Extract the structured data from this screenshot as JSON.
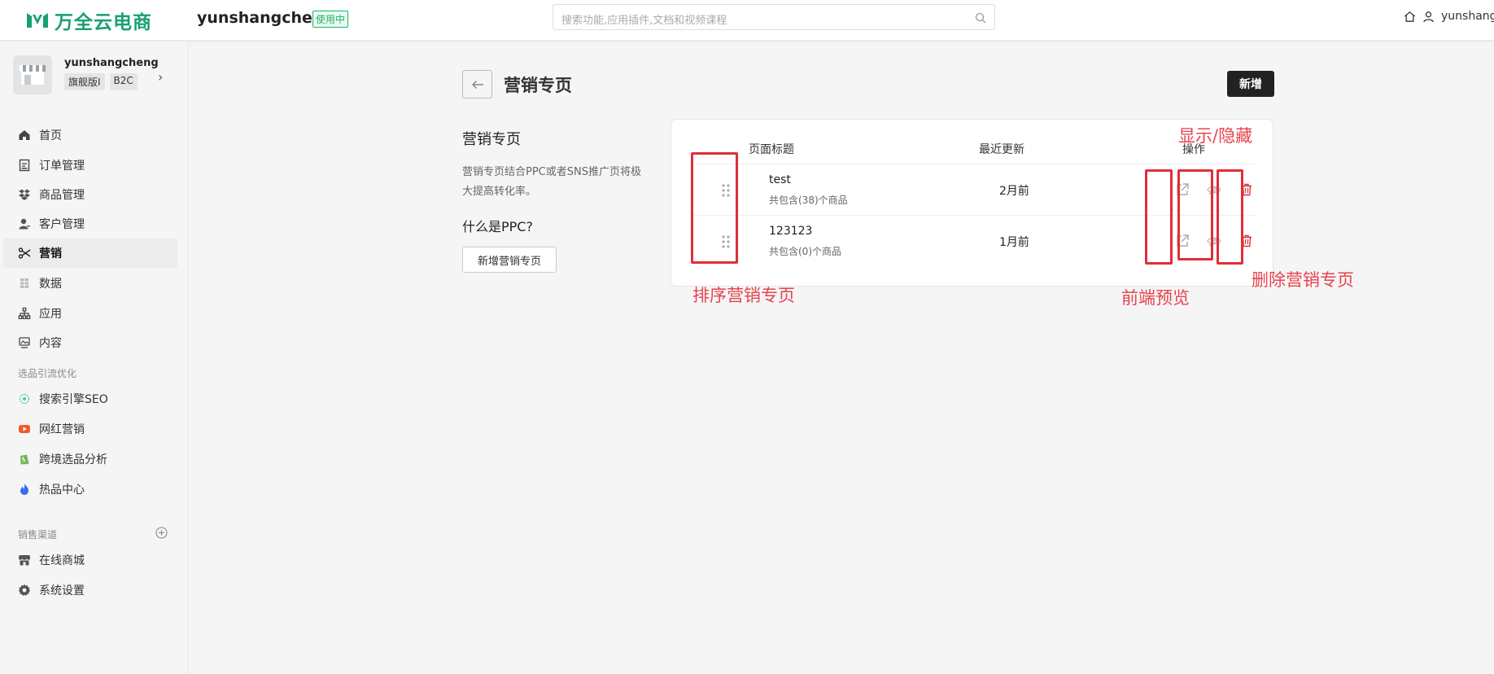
{
  "topbar": {
    "logo_text": "万全云电商",
    "store_name": "yunshangcheng",
    "store_status": "使用中",
    "search_placeholder": "搜索功能,应用插件,文档和视频课程",
    "user_name": "yunshangcheng"
  },
  "shop": {
    "name": "yunshangcheng",
    "tags": [
      "旗舰版I",
      "B2C"
    ]
  },
  "nav": {
    "main_items": [
      {
        "label": "首页",
        "icon": "home-icon"
      },
      {
        "label": "订单管理",
        "icon": "order-icon"
      },
      {
        "label": "商品管理",
        "icon": "product-icon"
      },
      {
        "label": "客户管理",
        "icon": "customer-icon"
      },
      {
        "label": "营销",
        "icon": "marketing-icon"
      },
      {
        "label": "数据",
        "icon": "data-icon"
      },
      {
        "label": "应用",
        "icon": "apps-icon"
      },
      {
        "label": "内容",
        "icon": "content-icon"
      }
    ],
    "section_optimization": "选品引流优化",
    "optimization_items": [
      {
        "label": "搜索引擎SEO",
        "icon": "seo-icon"
      },
      {
        "label": "网红营销",
        "icon": "youtube-icon"
      },
      {
        "label": "跨境选品分析",
        "icon": "shopify-icon"
      },
      {
        "label": "热品中心",
        "icon": "fire-icon"
      }
    ],
    "section_channels": "销售渠道",
    "channel_items": [
      {
        "label": "在线商城",
        "icon": "store-icon"
      },
      {
        "label": "系统设置",
        "icon": "settings-icon"
      }
    ]
  },
  "main": {
    "page_title": "营销专页",
    "add_button": "新增",
    "intro_title": "营销专页",
    "intro_desc": "营销专页结合PPC或者SNS推广页将极大提高转化率。",
    "ppc_title": "什么是PPC?",
    "new_page_button": "新增营销专页",
    "table": {
      "headers": [
        "页面标题",
        "最近更新",
        "操作"
      ],
      "rows": [
        {
          "title": "test",
          "sub": "共包含(38)个商品",
          "updated": "2月前"
        },
        {
          "title": "123123",
          "sub": "共包含(0)个商品",
          "updated": "1月前"
        }
      ]
    }
  },
  "annotations": {
    "sort": "排序营销专页",
    "toggle": "显示/隐藏",
    "preview": "前端预览",
    "delete": "删除营销专页"
  },
  "colors": {
    "brand": "#1aa06f",
    "annotation": "#e02e3a",
    "primary_button": "#222222"
  }
}
